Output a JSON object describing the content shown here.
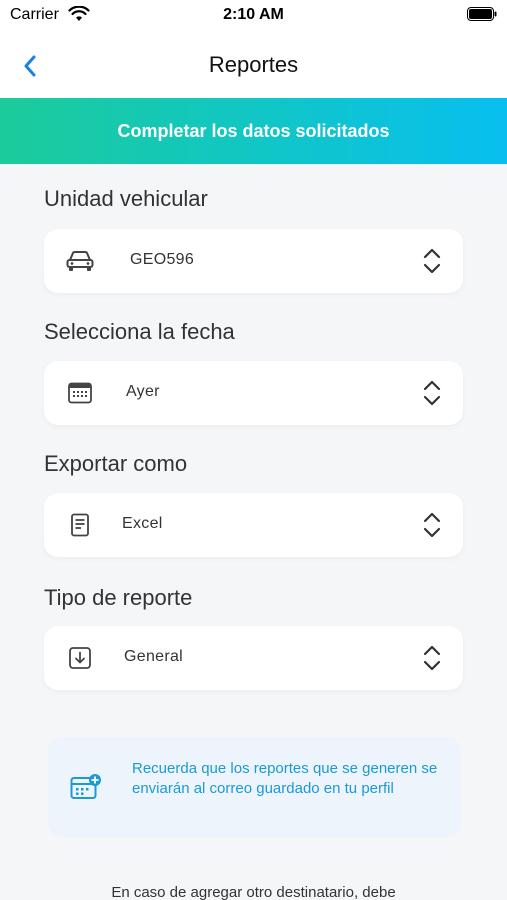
{
  "status_bar": {
    "carrier": "Carrier",
    "time": "2:10 AM",
    "wifi_icon": "wifi-icon",
    "battery_icon": "battery-icon"
  },
  "nav": {
    "title": "Reportes",
    "back_icon": "chevron-left-icon"
  },
  "banner": {
    "text": "Completar los datos solicitados"
  },
  "form": {
    "vehicle": {
      "label": "Unidad vehicular",
      "value": "GEO596",
      "icon": "car-icon"
    },
    "date": {
      "label": "Selecciona la fecha",
      "value": "Ayer",
      "icon": "calendar-icon"
    },
    "export": {
      "label": "Exportar como",
      "value": "Excel",
      "icon": "document-icon"
    },
    "report_type": {
      "label": "Tipo de reporte",
      "value": "General",
      "icon": "download-icon"
    }
  },
  "info": {
    "text": "Recuerda que los reportes que se generen se enviarán al correo guardado en tu perfil",
    "icon": "calendar-add-icon"
  },
  "footer": {
    "text": "En caso de agregar otro destinatario, debe"
  },
  "colors": {
    "accent": "#1a7fe6",
    "info_text": "#1a9ad6",
    "banner_start": "#1ccb9a",
    "banner_end": "#08bff0"
  }
}
